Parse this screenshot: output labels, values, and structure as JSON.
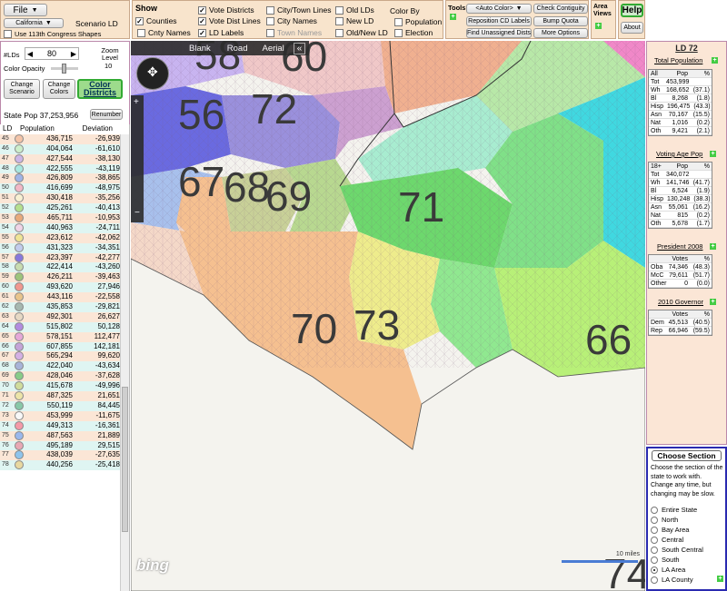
{
  "file": {
    "label": "File",
    "state": "California",
    "mode_label": "Scenario LD",
    "shapes_checkbox": "Use 113th Congress Shapes"
  },
  "show": {
    "heading": "Show",
    "items": [
      {
        "label": "Counties",
        "checked": true
      },
      {
        "label": "Vote Districts",
        "checked": true
      },
      {
        "label": "City/Town Lines",
        "checked": false
      },
      {
        "label": "Old LDs",
        "checked": false
      },
      {
        "label": "Cnty Names",
        "checked": false
      },
      {
        "label": "Vote Dist Lines",
        "checked": true
      },
      {
        "label": "City Names",
        "checked": false
      },
      {
        "label": "New LD",
        "checked": false
      },
      {
        "label": "LD Labels",
        "checked": true
      },
      {
        "label": "Town Names",
        "checked": false,
        "disabled": true
      },
      {
        "label": "Old/New LD",
        "checked": false
      }
    ],
    "color_by_heading": "Color By",
    "color_by": [
      {
        "label": "Population",
        "checked": false
      },
      {
        "label": "Election",
        "checked": false
      }
    ]
  },
  "tools": {
    "heading": "Tools",
    "auto_color": "<Auto Color>",
    "buttons": [
      "Check Contiguity",
      "Reposition CD Labels",
      "Bump Quota",
      "Find Unassigned Dists",
      "More Options"
    ]
  },
  "area_views": {
    "heading": "Area Views"
  },
  "help": {
    "help_label": "Help",
    "about_label": "About"
  },
  "left": {
    "lds_label": "#LDs",
    "lds_value": "80",
    "zoom_label": "Zoom Level",
    "zoom_value": "10",
    "opacity_label": "Color Opacity",
    "change_scenario": "Change Scenario",
    "change_colors": "Change Colors",
    "color_districts": "Color Districts",
    "state_pop_label": "State Pop",
    "state_pop_value": "37,253,956",
    "renumber": "Renumber",
    "table_headers": [
      "LD",
      "Population",
      "Deviation"
    ],
    "rows": [
      {
        "ld": "45",
        "pop": "436,715",
        "dev": "-26,939",
        "color": "#f4c4a8",
        "bg": "#fbe6d6"
      },
      {
        "ld": "46",
        "pop": "404,064",
        "dev": "-61,610",
        "color": "#cdeecb",
        "bg": "#dff5f2"
      },
      {
        "ld": "47",
        "pop": "427,544",
        "dev": "-38,130",
        "color": "#ccb6e6",
        "bg": "#fbe6d6"
      },
      {
        "ld": "48",
        "pop": "422,555",
        "dev": "-43,119",
        "color": "#a9e8e0",
        "bg": "#dff5f2"
      },
      {
        "ld": "49",
        "pop": "426,809",
        "dev": "-38,865",
        "color": "#a0b4e6",
        "bg": "#fbe6d6"
      },
      {
        "ld": "50",
        "pop": "416,699",
        "dev": "-48,975",
        "color": "#f2b8c6",
        "bg": "#dff5f2"
      },
      {
        "ld": "51",
        "pop": "430,418",
        "dev": "-35,256",
        "color": "#f7f0d2",
        "bg": "#fbe6d6"
      },
      {
        "ld": "52",
        "pop": "425,261",
        "dev": "-40,413",
        "color": "#b5e08f",
        "bg": "#dff5f2"
      },
      {
        "ld": "53",
        "pop": "465,711",
        "dev": "-10,953",
        "color": "#e8aa7c",
        "bg": "#fbe6d6"
      },
      {
        "ld": "54",
        "pop": "440,963",
        "dev": "-24,711",
        "color": "#f0d4e6",
        "bg": "#dff5f2"
      },
      {
        "ld": "55",
        "pop": "423,612",
        "dev": "-42,062",
        "color": "#efe496",
        "bg": "#fbe6d6"
      },
      {
        "ld": "56",
        "pop": "431,323",
        "dev": "-34,351",
        "color": "#c2ccec",
        "bg": "#dff5f2"
      },
      {
        "ld": "57",
        "pop": "423,397",
        "dev": "-42,277",
        "color": "#8878dc",
        "bg": "#fbe6d6"
      },
      {
        "ld": "58",
        "pop": "422,414",
        "dev": "-43,260",
        "color": "#c8dcb0",
        "bg": "#dff5f2"
      },
      {
        "ld": "59",
        "pop": "426,211",
        "dev": "-39,463",
        "color": "#9ec47c",
        "bg": "#fbe6d6"
      },
      {
        "ld": "60",
        "pop": "493,620",
        "dev": "27,946",
        "color": "#f09890",
        "bg": "#dff5f2"
      },
      {
        "ld": "61",
        "pop": "443,116",
        "dev": "-22,558",
        "color": "#e8c48c",
        "bg": "#fbe6d6"
      },
      {
        "ld": "62",
        "pop": "435,853",
        "dev": "-29,821",
        "color": "#a6b8b0",
        "bg": "#dff5f2"
      },
      {
        "ld": "63",
        "pop": "492,301",
        "dev": "26,627",
        "color": "#e6d8c4",
        "bg": "#fbe6d6"
      },
      {
        "ld": "64",
        "pop": "515,802",
        "dev": "50,128",
        "color": "#b28ce0",
        "bg": "#dff5f2"
      },
      {
        "ld": "65",
        "pop": "578,151",
        "dev": "112,477",
        "color": "#e6a8d8",
        "bg": "#fbe6d6"
      },
      {
        "ld": "66",
        "pop": "607,855",
        "dev": "142,181",
        "color": "#c4a4d8",
        "bg": "#dff5f2"
      },
      {
        "ld": "67",
        "pop": "565,294",
        "dev": "99,620",
        "color": "#d4b0e4",
        "bg": "#fbe6d6"
      },
      {
        "ld": "68",
        "pop": "422,040",
        "dev": "-43,634",
        "color": "#a8b4d8",
        "bg": "#dff5f2"
      },
      {
        "ld": "69",
        "pop": "428,046",
        "dev": "-37,628",
        "color": "#88cc88",
        "bg": "#fbe6d6"
      },
      {
        "ld": "70",
        "pop": "415,678",
        "dev": "-49,996",
        "color": "#d0dc9c",
        "bg": "#dff5f2"
      },
      {
        "ld": "71",
        "pop": "487,325",
        "dev": "21,651",
        "color": "#ece4a8",
        "bg": "#fbe6d6"
      },
      {
        "ld": "72",
        "pop": "550,119",
        "dev": "84,445",
        "color": "#88c8a8",
        "bg": "#dff5f2"
      },
      {
        "ld": "73",
        "pop": "453,999",
        "dev": "-11,675",
        "color": "#f8f8f8",
        "bg": "#fbe6d6"
      },
      {
        "ld": "74",
        "pop": "449,313",
        "dev": "-16,361",
        "color": "#f49aa8",
        "bg": "#dff5f2"
      },
      {
        "ld": "75",
        "pop": "487,563",
        "dev": "21,889",
        "color": "#9ab8ec",
        "bg": "#fbe6d6"
      },
      {
        "ld": "76",
        "pop": "495,189",
        "dev": "29,515",
        "color": "#e8a8b4",
        "bg": "#dff5f2"
      },
      {
        "ld": "77",
        "pop": "438,039",
        "dev": "-27,635",
        "color": "#8ec4ec",
        "bg": "#fbe6d6"
      },
      {
        "ld": "78",
        "pop": "440,256",
        "dev": "-25,418",
        "color": "#e8d8a0",
        "bg": "#dff5f2"
      }
    ]
  },
  "map": {
    "views": [
      "Blank",
      "Road",
      "Aerial"
    ],
    "collapse": "«",
    "logo": "bing",
    "labels": [
      {
        "text": "58"
      },
      {
        "text": "60"
      },
      {
        "text": "56"
      },
      {
        "text": "72"
      },
      {
        "text": "67"
      },
      {
        "text": "68"
      },
      {
        "text": "69"
      },
      {
        "text": "71"
      },
      {
        "text": "70"
      },
      {
        "text": "73"
      },
      {
        "text": "66"
      },
      {
        "text": "74"
      }
    ],
    "scale_text": "10 miles"
  },
  "stats": {
    "title": "LD 72",
    "total_pop_heading": "Total Population",
    "total_pop": [
      [
        "All",
        "Pop",
        "%"
      ],
      [
        "Tot",
        "453,999",
        ""
      ],
      [
        "Wh",
        "168,652",
        "(37.1)"
      ],
      [
        "Bl",
        "8,268",
        "(1.8)"
      ],
      [
        "Hisp",
        "196,475",
        "(43.3)"
      ],
      [
        "Asn",
        "70,167",
        "(15.5)"
      ],
      [
        "Nat",
        "1,016",
        "(0.2)"
      ],
      [
        "Oth",
        "9,421",
        "(2.1)"
      ]
    ],
    "vap_heading": "Voting Age Pop",
    "vap": [
      [
        "18+",
        "Pop",
        "%"
      ],
      [
        "Tot",
        "340,072",
        ""
      ],
      [
        "Wh",
        "141,746",
        "(41.7)"
      ],
      [
        "Bl",
        "6,524",
        "(1.9)"
      ],
      [
        "Hisp",
        "130,248",
        "(38.3)"
      ],
      [
        "Asn",
        "55,061",
        "(16.2)"
      ],
      [
        "Nat",
        "815",
        "(0.2)"
      ],
      [
        "Oth",
        "5,678",
        "(1.7)"
      ]
    ],
    "pres_heading": "President 2008",
    "pres": [
      [
        "",
        "Votes",
        "%"
      ],
      [
        "Oba",
        "74,346",
        "(48.3)"
      ],
      [
        "McC",
        "79,611",
        "(51.7)"
      ],
      [
        "Other",
        "0",
        "(0.0)"
      ]
    ],
    "gov_heading": "2010 Governor",
    "gov": [
      [
        "",
        "Votes",
        "%"
      ],
      [
        "Dem",
        "45,513",
        "(40.5)"
      ],
      [
        "Rep",
        "66,946",
        "(59.5)"
      ]
    ]
  },
  "section": {
    "title": "Choose Section",
    "desc": "Choose the section of the state to work with. Change any time, but changing may be slow.",
    "options": [
      {
        "label": "Entire State",
        "selected": false
      },
      {
        "label": "North",
        "selected": false
      },
      {
        "label": "Bay Area",
        "selected": false
      },
      {
        "label": "Central",
        "selected": false
      },
      {
        "label": "South Central",
        "selected": false
      },
      {
        "label": "South",
        "selected": false
      },
      {
        "label": "LA Area",
        "selected": true
      },
      {
        "label": "LA County",
        "selected": false
      }
    ]
  }
}
